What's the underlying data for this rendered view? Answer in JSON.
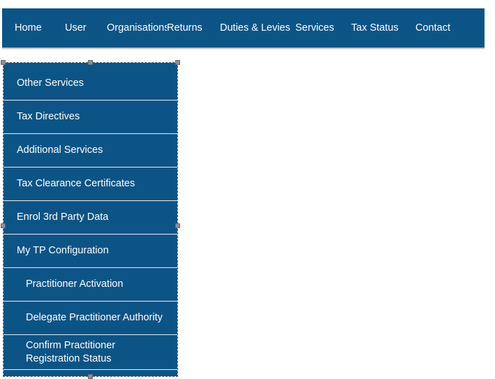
{
  "page": {
    "background_color": "#ffffff",
    "accent_color": "#0d5486",
    "text_color": "#ffffff",
    "separator_color": "#e8edf1",
    "selection_border_color": "#5b6b78",
    "handle_color": "#8b8f93"
  },
  "topnav": {
    "items": [
      {
        "label": "Home"
      },
      {
        "label": "User"
      },
      {
        "label": "Organisations"
      },
      {
        "label": "Returns"
      },
      {
        "label": "Duties & Levies"
      },
      {
        "label": "Services"
      },
      {
        "label": "Tax Status"
      },
      {
        "label": "Contact"
      }
    ]
  },
  "sidebar": {
    "items": [
      {
        "label": "Other Services",
        "level": 0
      },
      {
        "label": "Tax Directives",
        "level": 0
      },
      {
        "label": "Additional Services",
        "level": 0
      },
      {
        "label": "Tax Clearance Certificates",
        "level": 0
      },
      {
        "label": "Enrol 3rd Party Data",
        "level": 0
      },
      {
        "label": "My TP Configuration",
        "level": 0
      },
      {
        "label": "Practitioner Activation",
        "level": 1
      },
      {
        "label": "Delegate Practitioner Authority",
        "level": 1
      },
      {
        "label": "Confirm Practitioner Registration Status",
        "level": 1
      }
    ]
  }
}
